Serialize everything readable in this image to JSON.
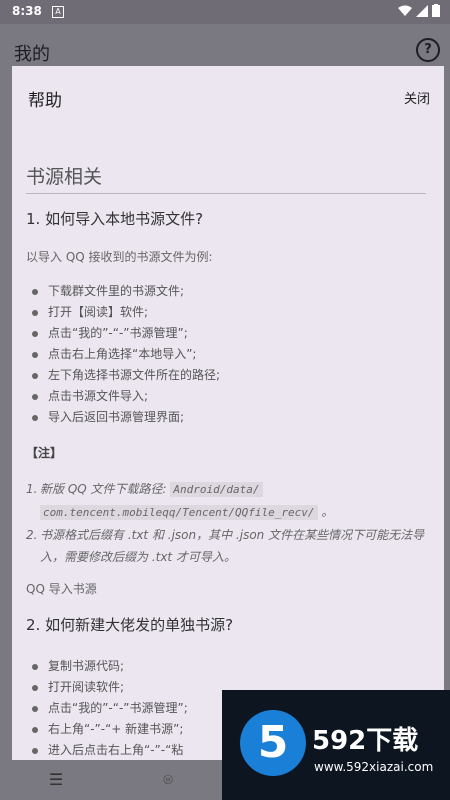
{
  "status": {
    "time": "8:38",
    "app_icon": "A"
  },
  "appbar": {
    "title": "我的",
    "help_icon": "?"
  },
  "dialog": {
    "title": "帮助",
    "close": "关闭",
    "section_title": "书源相关",
    "q1": "1. 如何导入本地书源文件?",
    "q1_intro": "以导入 QQ 接收到的书源文件为例:",
    "q1_steps": [
      "下载群文件里的书源文件;",
      "打开【阅读】软件;",
      "点击“我的”-“-”书源管理”;",
      "点击右上角选择“本地导入”;",
      "左下角选择书源文件所在的路径;",
      "点击书源文件导入;",
      "导入后返回书源管理界面;"
    ],
    "note_label": "【注】",
    "note1_text": "新版 QQ 文件下载路径:",
    "note1_code_a": "Android/data/",
    "note1_code_b": "com.tencent.mobileqq/Tencent/QQfile_recv/",
    "note1_end": "。",
    "note2_text": "书源格式后缀有 .txt 和 .json，其中 .json 文件在某些情况下可能无法导入，需要修改后缀为 .txt 才可导入。",
    "qq_import": "QQ 导入书源",
    "q2": "2. 如何新建大佬发的单独书源?",
    "q2_steps": [
      "复制书源代码;",
      "打开阅读软件;",
      "点击“我的”-“-”书源管理”;",
      "右上角“-”-“+ 新建书源”;",
      "进入后点击右上角“-”-“粘"
    ]
  },
  "watermark": {
    "logo": "5",
    "brand": "592下载",
    "url": "www.592xiazai.com"
  }
}
